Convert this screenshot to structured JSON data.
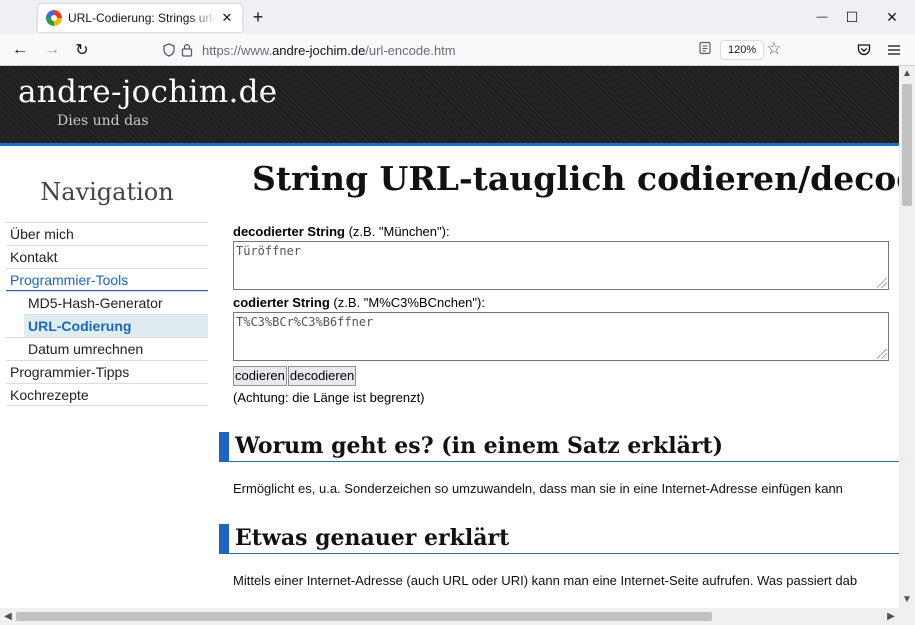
{
  "browser": {
    "tab_title": "URL-Codierung: Strings url-konform",
    "tab_close": "✕",
    "new_tab": "+",
    "url_prefix": "https://www.",
    "url_host": "andre-jochim.de",
    "url_path": "/url-encode.htm",
    "zoom": "120%"
  },
  "icons": {
    "back": "←",
    "forward": "→",
    "reload": "↻",
    "star": "☆",
    "minimize": "—",
    "maximize": "☐",
    "close": "✕",
    "scroll_up": "▲",
    "scroll_down": "▼",
    "scroll_left": "◀",
    "scroll_right": "▶"
  },
  "site": {
    "title": "andre-jochim.de",
    "subtitle": "Dies und das"
  },
  "sidebar": {
    "heading": "Navigation",
    "items": [
      {
        "label": "Über mich"
      },
      {
        "label": "Kontakt"
      },
      {
        "label": "Programmier-Tools"
      },
      {
        "label": "MD5-Hash-Generator"
      },
      {
        "label": "URL-Codierung"
      },
      {
        "label": "Datum umrechnen"
      },
      {
        "label": "Programmier-Tipps"
      },
      {
        "label": "Kochrezepte"
      }
    ]
  },
  "main": {
    "title": "String URL-tauglich codieren/decodieren",
    "decoded_label_bold": "decodierter String",
    "decoded_label_rest": " (z.B. \"München\"):",
    "decoded_value": "Türöffner",
    "encoded_label_bold": "codierter String",
    "encoded_label_rest": " (z.B. \"M%C3%BCnchen\"):",
    "encoded_value": "T%C3%BCr%C3%B6ffner",
    "encode_button": "codieren",
    "decode_button": "decodieren",
    "note": "(Achtung: die Länge ist begrenzt)",
    "section1_heading": "Worum geht es? (in einem Satz erklärt)",
    "section1_text": "Ermöglicht es, u.a. Sonderzeichen so umzuwandeln, dass man sie in eine Internet-Adresse einfügen kann",
    "section2_heading": "Etwas genauer erklärt",
    "section2_text": "Mittels einer Internet-Adresse (auch URL oder URI) kann man eine Internet-Seite aufrufen. Was passiert dab"
  }
}
